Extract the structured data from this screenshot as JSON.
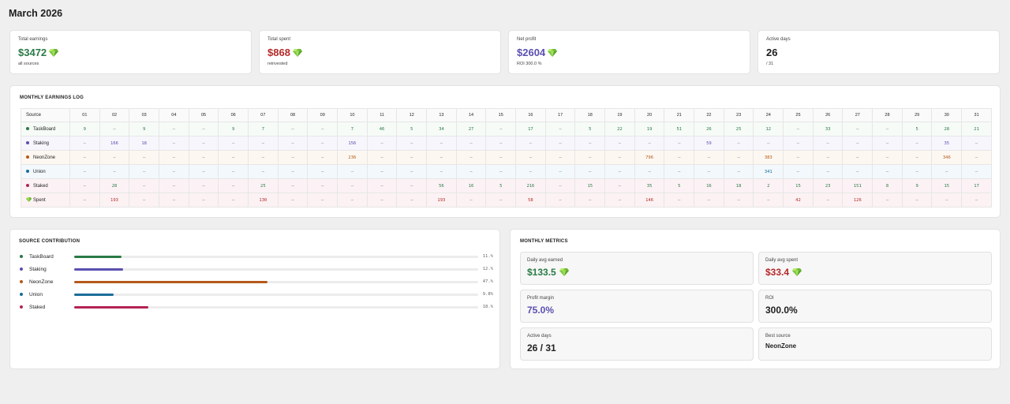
{
  "page_title": "March 2026",
  "stats": [
    {
      "label": "Total earnings",
      "value": "$3472",
      "sub": "all sources",
      "color": "#2a7a46",
      "gem": true
    },
    {
      "label": "Total spent",
      "value": "$868",
      "sub": "reinvested",
      "color": "#b52a2a",
      "gem": true
    },
    {
      "label": "Net profit",
      "value": "$2604",
      "sub": "ROI 300.0 %",
      "color": "#5a4fb0",
      "gem": true
    },
    {
      "label": "Active days",
      "value": "26",
      "sub": "/ 31",
      "color": "#1f1f1f",
      "gem": false
    }
  ],
  "log": {
    "title": "MONTHLY EARNINGS LOG",
    "source_header": "Source",
    "days": [
      "01",
      "02",
      "03",
      "04",
      "05",
      "06",
      "07",
      "08",
      "09",
      "10",
      "11",
      "12",
      "13",
      "14",
      "15",
      "16",
      "17",
      "18",
      "19",
      "20",
      "21",
      "22",
      "23",
      "24",
      "25",
      "26",
      "27",
      "28",
      "29",
      "30",
      "31"
    ],
    "rows": [
      {
        "name": "TaskBoard",
        "key": "taskboard",
        "color": "#2a7a46",
        "cls": "c-green",
        "values": [
          "9",
          "–",
          "9",
          "–",
          "–",
          "9",
          "7",
          "–",
          "–",
          "7",
          "46",
          "5",
          "34",
          "27",
          "–",
          "17",
          "–",
          "5",
          "22",
          "19",
          "51",
          "26",
          "25",
          "12",
          "–",
          "33",
          "–",
          "–",
          "5",
          "28",
          "21"
        ]
      },
      {
        "name": "Staking",
        "key": "staking",
        "color": "#5a4fb0",
        "cls": "c-purple",
        "values": [
          "–",
          "166",
          "18",
          "–",
          "–",
          "–",
          "–",
          "–",
          "–",
          "156",
          "–",
          "–",
          "–",
          "–",
          "–",
          "–",
          "–",
          "–",
          "–",
          "–",
          "–",
          "59",
          "–",
          "–",
          "–",
          "–",
          "–",
          "–",
          "–",
          "35",
          "–"
        ]
      },
      {
        "name": "NeonZone",
        "key": "neonzone",
        "color": "#b45a1a",
        "cls": "c-orange",
        "values": [
          "–",
          "–",
          "–",
          "–",
          "–",
          "–",
          "–",
          "–",
          "–",
          "236",
          "–",
          "–",
          "–",
          "–",
          "–",
          "–",
          "–",
          "–",
          "–",
          "796",
          "–",
          "–",
          "–",
          "383",
          "–",
          "–",
          "–",
          "–",
          "–",
          "346",
          "–"
        ]
      },
      {
        "name": "Union",
        "key": "union",
        "color": "#1a6d98",
        "cls": "c-blue",
        "values": [
          "–",
          "–",
          "–",
          "–",
          "–",
          "–",
          "–",
          "–",
          "–",
          "–",
          "–",
          "–",
          "–",
          "–",
          "–",
          "–",
          "–",
          "–",
          "–",
          "–",
          "–",
          "–",
          "–",
          "341",
          "–",
          "–",
          "–",
          "–",
          "–",
          "–",
          "–"
        ]
      },
      {
        "name": "Staked",
        "key": "staked",
        "color": "#b32455",
        "cls": "c-green",
        "values": [
          "–",
          "28",
          "–",
          "–",
          "–",
          "–",
          "25",
          "–",
          "–",
          "–",
          "–",
          "–",
          "56",
          "16",
          "5",
          "216",
          "–",
          "15",
          "–",
          "35",
          "5",
          "16",
          "18",
          "2",
          "15",
          "23",
          "151",
          "8",
          "9",
          "15",
          "17"
        ]
      },
      {
        "name": "Spent",
        "key": "spent",
        "color": "",
        "cls": "c-red",
        "gem": true,
        "values": [
          "–",
          "193",
          "–",
          "–",
          "–",
          "–",
          "130",
          "–",
          "–",
          "–",
          "–",
          "–",
          "193",
          "–",
          "–",
          "58",
          "–",
          "–",
          "–",
          "146",
          "–",
          "–",
          "–",
          "–",
          "42",
          "–",
          "126",
          "–",
          "–",
          "–",
          "–"
        ]
      }
    ]
  },
  "contribution": {
    "title": "SOURCE CONTRIBUTION",
    "items": [
      {
        "name": "TaskBoard",
        "pct": "11.%",
        "fraction": 0.117,
        "color": "#2a7a46"
      },
      {
        "name": "Staking",
        "pct": "12.%",
        "fraction": 0.122,
        "color": "#5a4fb0"
      },
      {
        "name": "NeonZone",
        "pct": "47.%",
        "fraction": 0.479,
        "color": "#b45a1a"
      },
      {
        "name": "Union",
        "pct": "9.8%",
        "fraction": 0.098,
        "color": "#1a6d98"
      },
      {
        "name": "Staked",
        "pct": "18.%",
        "fraction": 0.183,
        "color": "#b32455"
      }
    ]
  },
  "metrics": {
    "title": "MONTHLY METRICS",
    "items": [
      {
        "label": "Daily avg earned",
        "value": "$133.5",
        "color": "#2a7a46",
        "gem": true
      },
      {
        "label": "Daily avg spent",
        "value": "$33.4",
        "color": "#b52a2a",
        "gem": true
      },
      {
        "label": "Profit margin",
        "value": "75.0%",
        "color": "#5a4fb0",
        "gem": false
      },
      {
        "label": "ROI",
        "value": "300.0%",
        "color": "#1f1f1f",
        "gem": false
      },
      {
        "label": "Active days",
        "value": "26 / 31",
        "color": "#1f1f1f",
        "gem": false
      },
      {
        "label": "Best source",
        "value": "NeonZone",
        "color": "#1f1f1f",
        "gem": false,
        "small": true
      }
    ]
  }
}
